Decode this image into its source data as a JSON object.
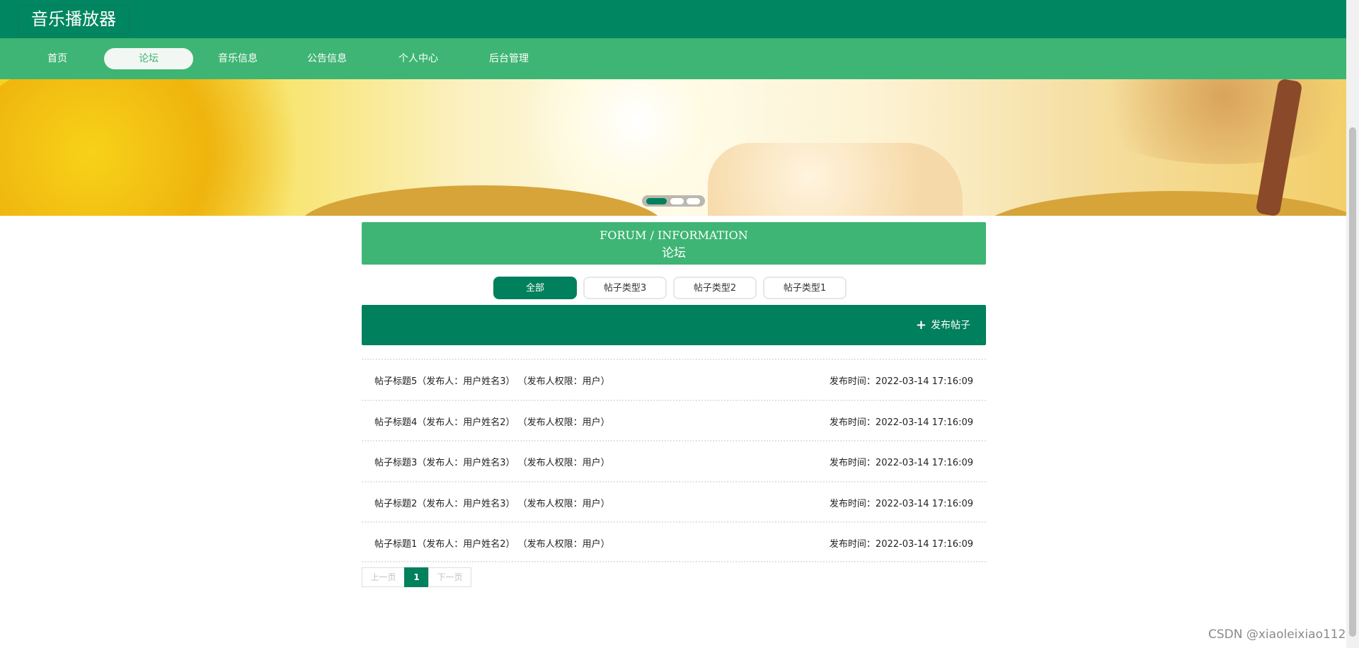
{
  "app": {
    "title": "音乐播放器"
  },
  "nav": {
    "items": [
      {
        "label": "首页"
      },
      {
        "label": "论坛"
      },
      {
        "label": "音乐信息"
      },
      {
        "label": "公告信息"
      },
      {
        "label": "个人中心"
      },
      {
        "label": "后台管理"
      }
    ],
    "active_index": 1
  },
  "banner": {
    "slides": 3,
    "active_slide": 0
  },
  "forum": {
    "heading_en": "FORUM / INFORMATION",
    "heading_cn": "论坛",
    "types": [
      {
        "label": "全部"
      },
      {
        "label": "帖子类型3"
      },
      {
        "label": "帖子类型2"
      },
      {
        "label": "帖子类型1"
      }
    ],
    "active_type": 0,
    "post_button_label": "发布帖子",
    "posts": [
      {
        "title": "帖子标题5（发布人：用户姓名3） （发布人权限：用户）",
        "time": "发布时间：2022-03-14 17:16:09"
      },
      {
        "title": "帖子标题4（发布人：用户姓名2） （发布人权限：用户）",
        "time": "发布时间：2022-03-14 17:16:09"
      },
      {
        "title": "帖子标题3（发布人：用户姓名3） （发布人权限：用户）",
        "time": "发布时间：2022-03-14 17:16:09"
      },
      {
        "title": "帖子标题2（发布人：用户姓名3） （发布人权限：用户）",
        "time": "发布时间：2022-03-14 17:16:09"
      },
      {
        "title": "帖子标题1（发布人：用户姓名2） （发布人权限：用户）",
        "time": "发布时间：2022-03-14 17:16:09"
      }
    ]
  },
  "pagination": {
    "prev_label": "上一页",
    "current_page": "1",
    "next_label": "下一页"
  },
  "watermark": "CSDN @xiaoleixiao112",
  "colors": {
    "dark_green": "#00805c",
    "light_green": "#3eb574"
  },
  "icons": {
    "post_button": "plus-icon"
  }
}
